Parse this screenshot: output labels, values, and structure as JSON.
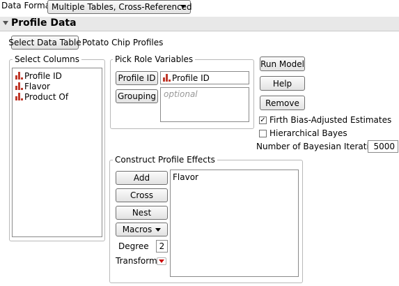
{
  "data_format": {
    "label": "Data Format",
    "value": "Multiple Tables, Cross-Referenced"
  },
  "section": {
    "title": "Profile Data"
  },
  "data_table": {
    "button_label": "Select Data Table",
    "table_name": "Potato Chip Profiles"
  },
  "select_columns": {
    "title": "Select Columns",
    "items": [
      {
        "label": "Profile ID",
        "icon": "nominal-column-icon"
      },
      {
        "label": "Flavor",
        "icon": "nominal-column-icon"
      },
      {
        "label": "Product Of",
        "icon": "nominal-column-icon"
      }
    ]
  },
  "pick_role": {
    "title": "Pick Role Variables",
    "profile_id_button": "Profile ID",
    "profile_id_value": "Profile ID",
    "grouping_button": "Grouping",
    "grouping_placeholder": "optional"
  },
  "actions": {
    "run_model": "Run Model",
    "help": "Help",
    "remove": "Remove"
  },
  "options": {
    "firth_label": "Firth Bias-Adjusted Estimates",
    "firth_checked": true,
    "hierarchical_label": "Hierarchical Bayes",
    "hierarchical_checked": false,
    "iterations_label": "Number of Bayesian Iterations",
    "iterations_value": "5000"
  },
  "construct": {
    "title": "Construct Profile Effects",
    "add": "Add",
    "cross": "Cross",
    "nest": "Nest",
    "macros": "Macros",
    "degree_label": "Degree",
    "degree_value": "2",
    "transform_label": "Transform",
    "effects": [
      "Flavor"
    ]
  },
  "colors": {
    "section_bg": "#e8e8e8",
    "column_icon": "#c0392b",
    "dropdown_triangle": "#cc0000"
  }
}
